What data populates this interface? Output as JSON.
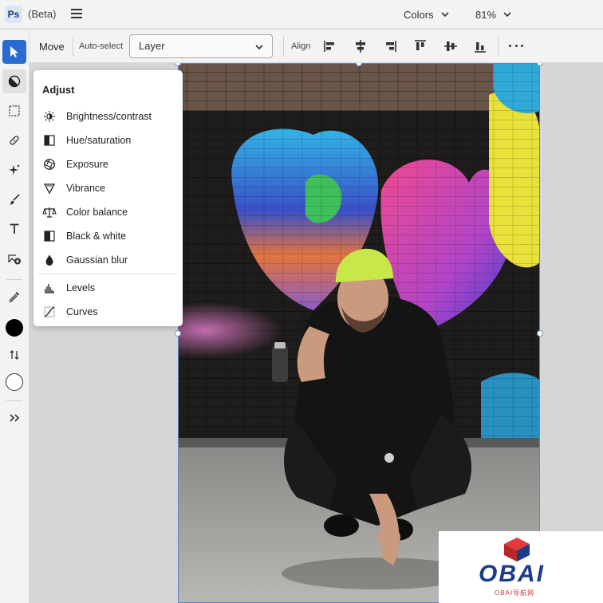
{
  "app": {
    "logo": "Ps",
    "title": "(Beta)"
  },
  "topbar": {
    "colors_label": "Colors",
    "zoom_label": "81%"
  },
  "options": {
    "tool_label": "Move",
    "autoselect_label": "Auto-select",
    "autoselect_value": "Layer",
    "align_label": "Align"
  },
  "tools": [
    {
      "name": "move-tool",
      "icon": "arrow-pointer-icon"
    },
    {
      "name": "adjustments-tool",
      "icon": "half-circle-icon"
    },
    {
      "name": "marquee-tool",
      "icon": "dashed-rect-icon"
    },
    {
      "name": "healing-tool",
      "icon": "bandage-icon"
    },
    {
      "name": "generative-fill-tool",
      "icon": "sparkle-icon"
    },
    {
      "name": "brush-tool",
      "icon": "brush-icon"
    },
    {
      "name": "type-tool",
      "icon": "type-icon"
    },
    {
      "name": "add-image-tool",
      "icon": "image-add-icon"
    },
    {
      "name": "eyedropper-tool",
      "icon": "eyedropper-icon"
    },
    {
      "name": "foreground-color",
      "icon": "filled-circle-icon"
    },
    {
      "name": "swap-colors",
      "icon": "swap-icon"
    },
    {
      "name": "background-color",
      "icon": "empty-circle-icon"
    },
    {
      "name": "expand-toolbar",
      "icon": "double-chevron-right-icon"
    }
  ],
  "adjust": {
    "title": "Adjust",
    "items": [
      {
        "label": "Brightness/contrast",
        "icon": "sun-icon"
      },
      {
        "label": "Hue/saturation",
        "icon": "half-square-icon"
      },
      {
        "label": "Exposure",
        "icon": "aperture-icon"
      },
      {
        "label": "Vibrance",
        "icon": "triangle-icon"
      },
      {
        "label": "Color balance",
        "icon": "scale-icon"
      },
      {
        "label": "Black & white",
        "icon": "bw-square-icon"
      },
      {
        "label": "Gaussian blur",
        "icon": "drop-icon"
      },
      {
        "label": "Levels",
        "icon": "histogram-icon"
      },
      {
        "label": "Curves",
        "icon": "curves-icon"
      }
    ]
  },
  "watermark": {
    "text": "OBAI",
    "sub": "OBAI导航网"
  },
  "colors": {
    "accent": "#2a6bd1",
    "selection": "#5b85cc"
  }
}
